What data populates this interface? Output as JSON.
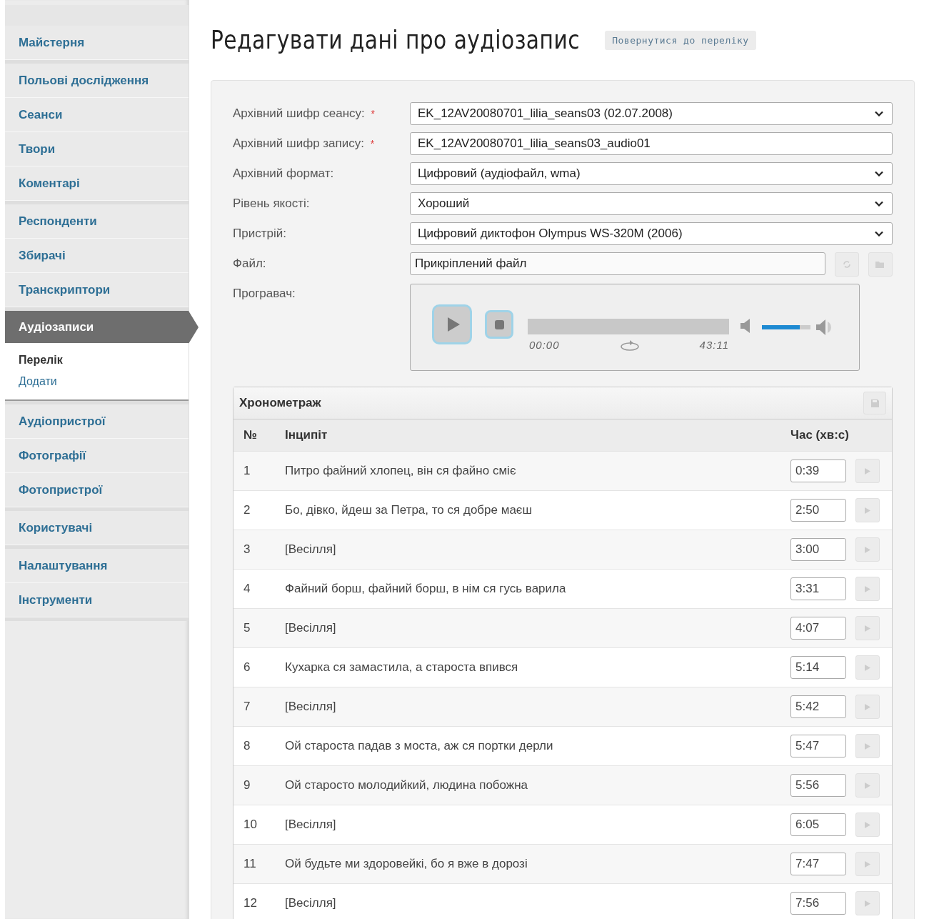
{
  "sidebar": {
    "groups": [
      {
        "items": [
          {
            "label": "Майстерня",
            "selected": false
          }
        ]
      },
      {
        "items": [
          {
            "label": "Польові дослідження",
            "selected": false
          },
          {
            "label": "Сеанси",
            "selected": false
          },
          {
            "label": "Твори",
            "selected": false
          },
          {
            "label": "Коментарі",
            "selected": false
          }
        ]
      },
      {
        "items": [
          {
            "label": "Респонденти",
            "selected": false
          },
          {
            "label": "Збирачі",
            "selected": false
          },
          {
            "label": "Транскриптори",
            "selected": false
          }
        ]
      },
      {
        "items": [
          {
            "label": "Аудіозаписи",
            "selected": true,
            "children": [
              {
                "label": "Перелік",
                "selected": true
              },
              {
                "label": "Додати",
                "selected": false
              }
            ]
          }
        ]
      },
      {
        "items": [
          {
            "label": "Аудіопристрої",
            "selected": false
          },
          {
            "label": "Фотографії",
            "selected": false
          },
          {
            "label": "Фотопристрої",
            "selected": false
          }
        ]
      },
      {
        "items": [
          {
            "label": "Користувачі",
            "selected": false
          }
        ]
      },
      {
        "items": [
          {
            "label": "Налаштування",
            "selected": false
          },
          {
            "label": "Інструменти",
            "selected": false
          }
        ]
      }
    ]
  },
  "page": {
    "title": "Редагувати дані про аудіозапис",
    "back_link": "Повернутися до переліку"
  },
  "form": {
    "rows": [
      {
        "kind": "select",
        "label": "Архівний шифр сеансу:",
        "required_mark": "*",
        "value": "EK_12AV20080701_lilia_seans03 (02.07.2008)"
      },
      {
        "kind": "input",
        "label": "Архівний шифр запису:",
        "required_mark": "*",
        "value": "EK_12AV20080701_lilia_seans03_audio01"
      },
      {
        "kind": "select",
        "label": "Архівний формат:",
        "value": "Цифровий (аудіофайл, wma)"
      },
      {
        "kind": "select",
        "label": "Рівень якості:",
        "value": "Хороший"
      },
      {
        "kind": "select",
        "label": "Пристрій:",
        "value": "Цифровий диктофон Olympus WS-320M (2006)"
      },
      {
        "kind": "file",
        "label": "Файл:",
        "value": "Прикріплений файл"
      },
      {
        "kind": "player",
        "label": "Програвач:",
        "player": {
          "current_time": "00:00",
          "duration": "43:11",
          "progress": {
            "level": 0
          },
          "volume": {
            "level": 0.78
          }
        }
      }
    ]
  },
  "table": {
    "title": "Хронометраж",
    "columns": [
      "№",
      "Інципіт",
      "Час (хв:с)"
    ],
    "rows": [
      {
        "number": "1",
        "incipit": "Питро файний хлопец, він ся файно сміє",
        "time": "0:39"
      },
      {
        "number": "2",
        "incipit": "Бо, дівко, йдеш за Петра, то ся добре маєш",
        "time": "2:50"
      },
      {
        "number": "3",
        "incipit": "[Весілля]",
        "time": "3:00"
      },
      {
        "number": "4",
        "incipit": "Файний борш, файний борш, в нім ся гусь варила",
        "time": "3:31"
      },
      {
        "number": "5",
        "incipit": "[Весілля]",
        "time": "4:07"
      },
      {
        "number": "6",
        "incipit": "Кухарка ся замастила, а староста впився",
        "time": "5:14"
      },
      {
        "number": "7",
        "incipit": "[Весілля]",
        "time": "5:42"
      },
      {
        "number": "8",
        "incipit": "Ой староста падав з моста, аж ся портки дерли",
        "time": "5:47"
      },
      {
        "number": "9",
        "incipit": "Ой старосто молодийкий, людина побожна",
        "time": "5:56"
      },
      {
        "number": "10",
        "incipit": "[Весілля]",
        "time": "6:05"
      },
      {
        "number": "11",
        "incipit": "Ой будьте ми здоровейкі, бо я вже в дорозі",
        "time": "7:47"
      },
      {
        "number": "12",
        "incipit": "[Весілля]",
        "time": "7:56"
      }
    ]
  }
}
